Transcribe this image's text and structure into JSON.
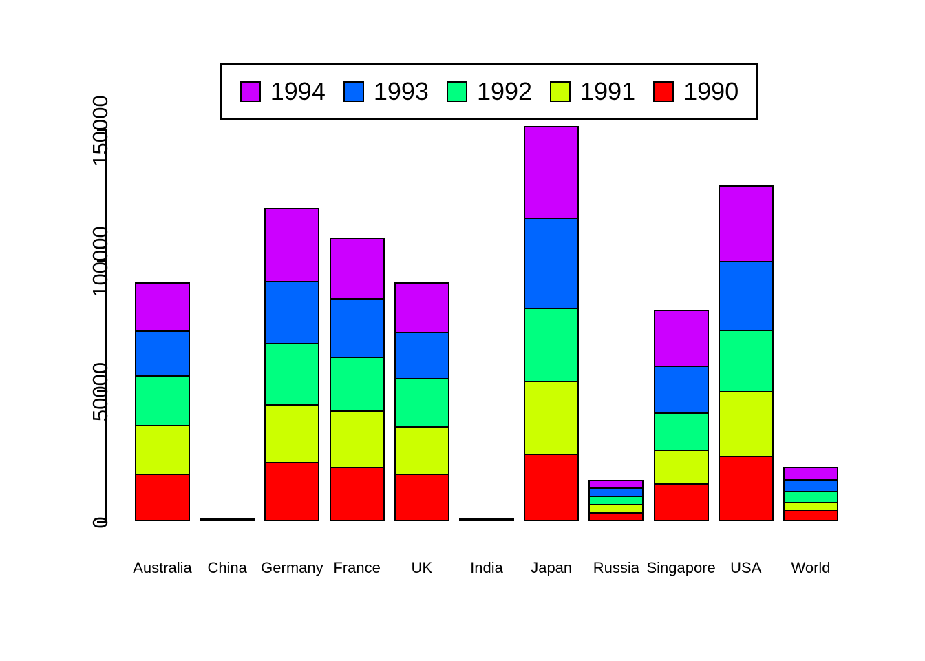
{
  "chart_data": {
    "type": "bar",
    "stacked": true,
    "title": "",
    "xlabel": "",
    "ylabel": "",
    "ylim": [
      0,
      155000
    ],
    "grid": false,
    "legend_position": "top",
    "y_ticks": [
      "0",
      "50000",
      "100000",
      "150000"
    ],
    "y_tick_values": [
      0,
      50000,
      100000,
      150000
    ],
    "categories": [
      "Australia",
      "China",
      "Germany",
      "France",
      "UK",
      "India",
      "Japan",
      "Russia",
      "Singapore",
      "USA",
      "World"
    ],
    "series": [
      {
        "name": "1990",
        "color": "#FF0000",
        "values": [
          18200,
          400,
          22600,
          20800,
          18200,
          400,
          25800,
          3400,
          14500,
          25000,
          4400
        ]
      },
      {
        "name": "1991",
        "color": "#CCFF00",
        "values": [
          18700,
          0,
          22100,
          21600,
          18200,
          0,
          27900,
          3200,
          12900,
          24700,
          3100
        ]
      },
      {
        "name": "1992",
        "color": "#00FF80",
        "values": [
          19000,
          0,
          23700,
          20600,
          18400,
          0,
          28100,
          3200,
          14300,
          23700,
          4200
        ]
      },
      {
        "name": "1993",
        "color": "#0066FF",
        "values": [
          17100,
          0,
          23700,
          22400,
          17600,
          0,
          34500,
          3200,
          17900,
          26300,
          4500
        ]
      },
      {
        "name": "1994",
        "color": "#CC00FF",
        "values": [
          18400,
          0,
          27900,
          23200,
          19200,
          0,
          35000,
          2900,
          21300,
          29000,
          4700
        ]
      }
    ]
  },
  "legend": {
    "entries": [
      {
        "label": "1994",
        "color": "#CC00FF"
      },
      {
        "label": "1993",
        "color": "#0066FF"
      },
      {
        "label": "1992",
        "color": "#00FF80"
      },
      {
        "label": "1991",
        "color": "#CCFF00"
      },
      {
        "label": "1990",
        "color": "#FF0000"
      }
    ]
  },
  "axis": {
    "y_labels": [
      "0",
      "50000",
      "100000",
      "150000"
    ]
  }
}
